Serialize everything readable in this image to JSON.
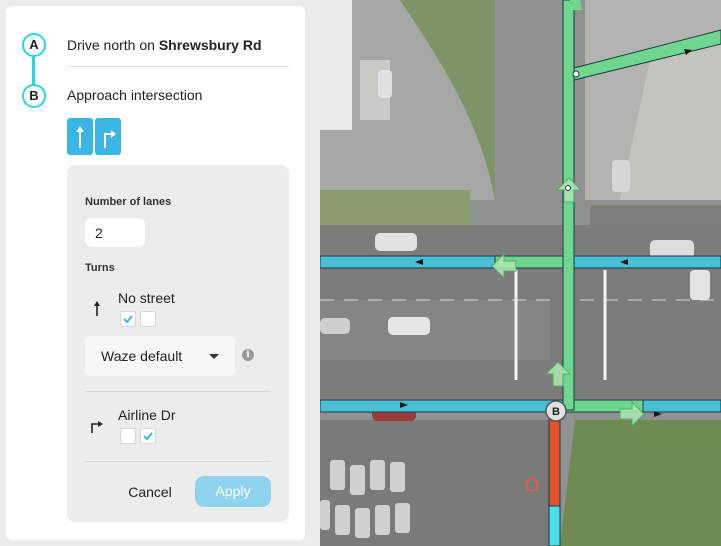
{
  "steps": [
    {
      "letter": "A",
      "prefix": "Drive north on ",
      "street": "Shrewsbury Rd"
    },
    {
      "letter": "B",
      "text": "Approach intersection"
    }
  ],
  "lane_buttons": [
    {
      "icon": "arrow-up-icon"
    },
    {
      "icon": "turn-right-icon"
    }
  ],
  "lanes_panel": {
    "lanes_label": "Number of lanes",
    "lanes_value": "2",
    "turns_label": "Turns",
    "turns": [
      {
        "icon": "arrow-up-icon",
        "name": "No street",
        "lane1_checked": true,
        "lane2_checked": false
      },
      {
        "icon": "turn-right-icon",
        "name": "Airline Dr",
        "lane1_checked": false,
        "lane2_checked": true
      }
    ],
    "guidance_select": "Waze default",
    "info_icon": "info-icon"
  },
  "actions": {
    "cancel": "Cancel",
    "apply": "Apply"
  },
  "map": {
    "node_label": "B",
    "colors": {
      "road_green": "#6fd68f",
      "road_blue": "#49bfd6",
      "road_red": "#e2522e",
      "accent": "#2bd6e0",
      "button": "#3bb6e4"
    }
  }
}
